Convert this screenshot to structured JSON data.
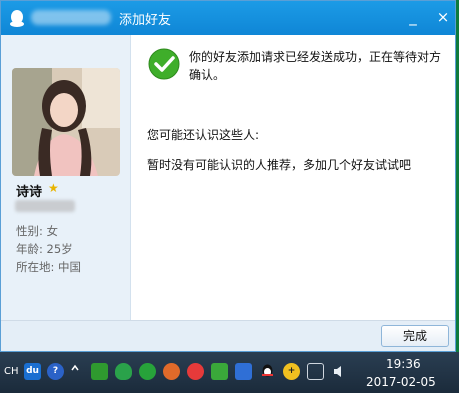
{
  "window": {
    "title": "添加好友",
    "close_label": "×",
    "minimize_label": "_"
  },
  "profile": {
    "nickname": "诗诗",
    "gender": "性别: 女",
    "age": "年龄: 25岁",
    "location": "所在地: 中国"
  },
  "messages": {
    "success": "你的好友添加请求已经发送成功，正在等待对方确认。",
    "maybe_know": "您可能还认识这些人:",
    "no_recommend": "暂时没有可能认识的人推荐，多加几个好友试试吧"
  },
  "footer": {
    "done_label": "完成"
  },
  "taskbar": {
    "ime_label": "CH",
    "du_label": "du",
    "help_label": "?",
    "time": "19:36",
    "date": "2017-02-05"
  },
  "colors": {
    "titlebar": "#1396e3",
    "accent_green": "#3fae2a"
  }
}
